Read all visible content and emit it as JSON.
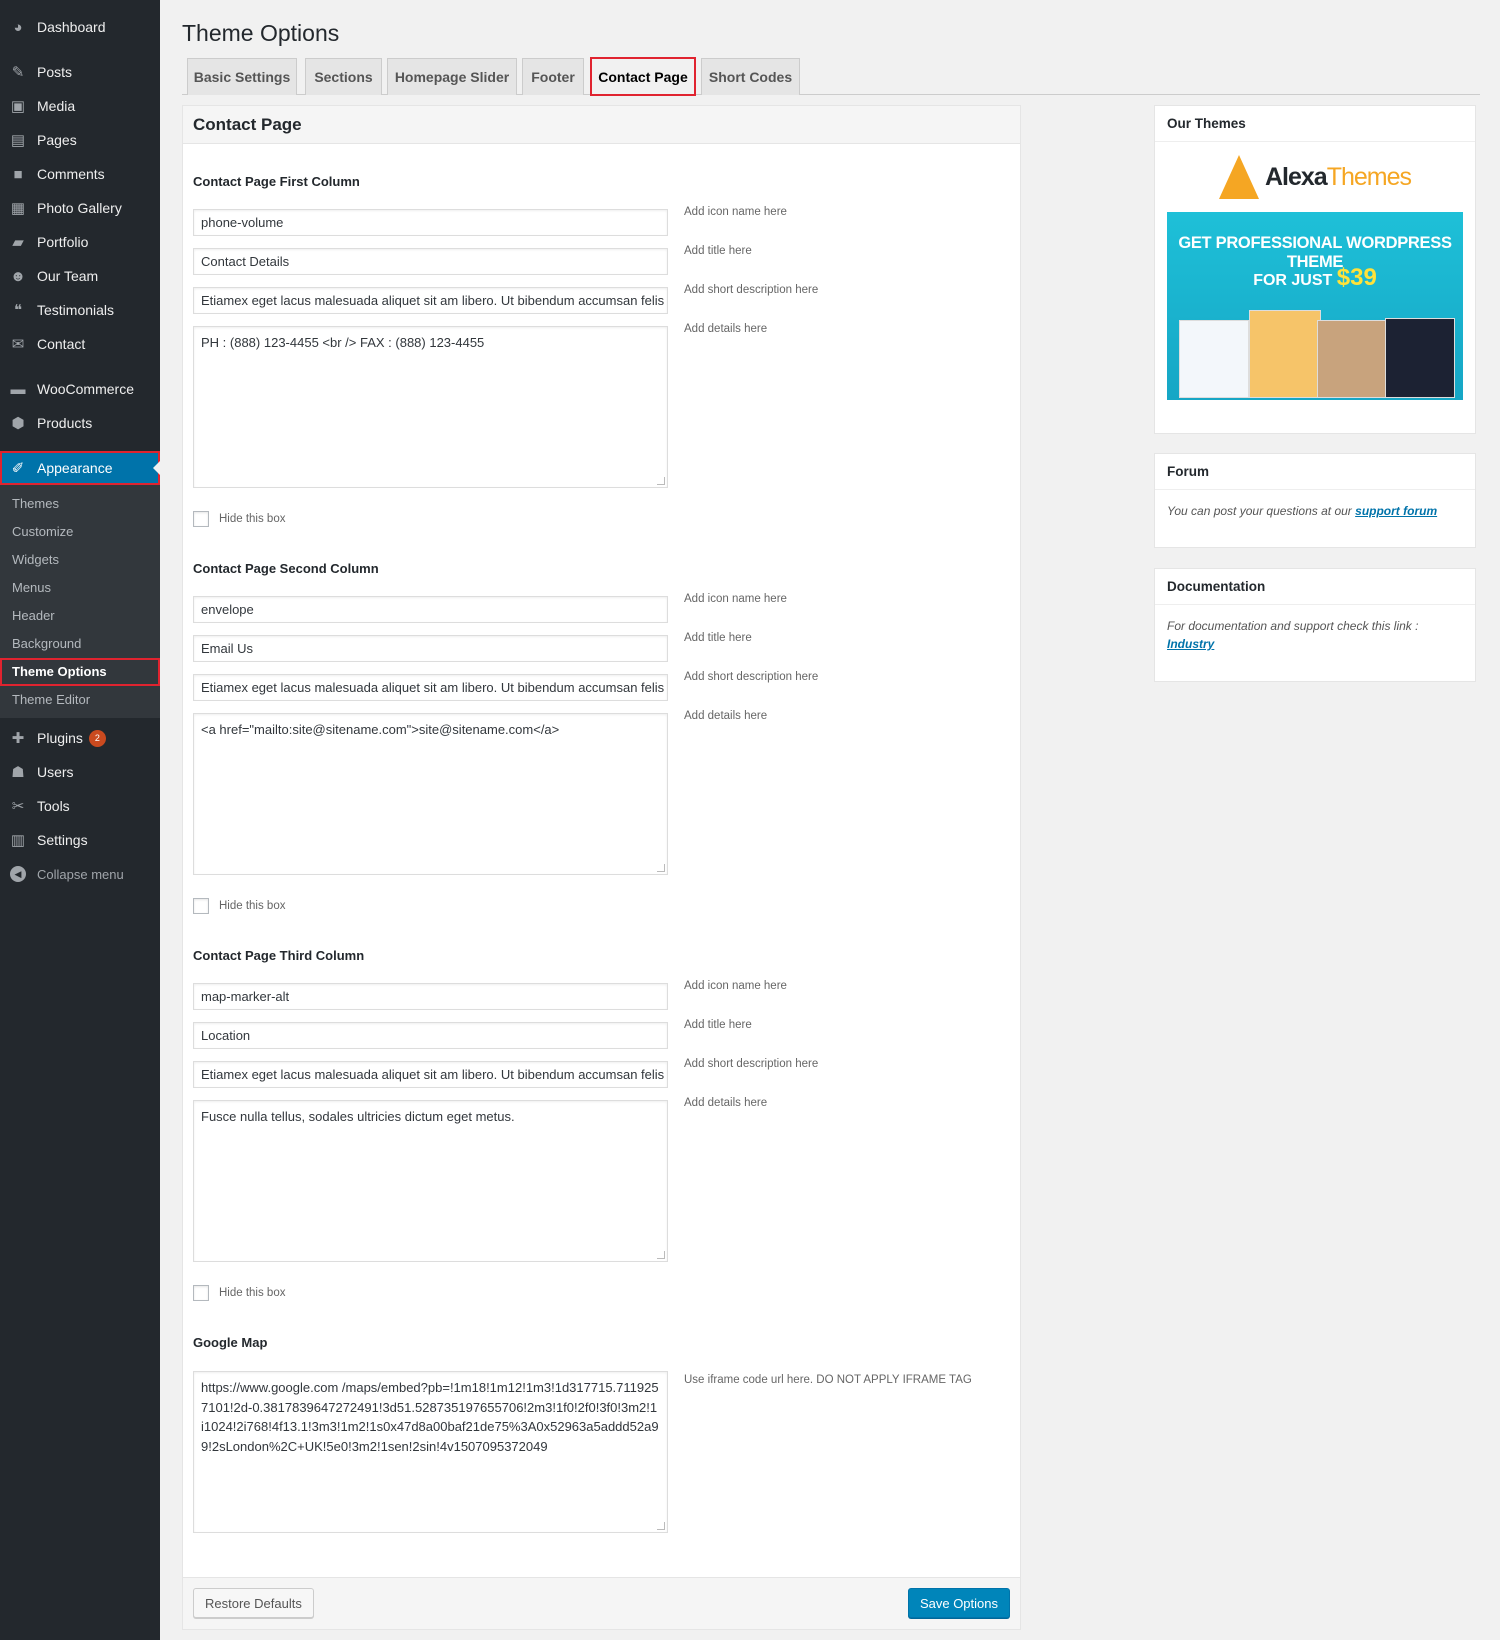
{
  "sidebar": {
    "items": [
      {
        "label": "Dashboard",
        "icon": "dashboard-icon",
        "glyph": "◕"
      },
      {
        "label": "Posts",
        "icon": "pin-icon",
        "glyph": "✎"
      },
      {
        "label": "Media",
        "icon": "media-icon",
        "glyph": "▣"
      },
      {
        "label": "Pages",
        "icon": "pages-icon",
        "glyph": "▤"
      },
      {
        "label": "Comments",
        "icon": "comments-icon",
        "glyph": "■"
      },
      {
        "label": "Photo Gallery",
        "icon": "gallery-icon",
        "glyph": "▦"
      },
      {
        "label": "Portfolio",
        "icon": "portfolio-icon",
        "glyph": "▰"
      },
      {
        "label": "Our Team",
        "icon": "team-icon",
        "glyph": "☻"
      },
      {
        "label": "Testimonials",
        "icon": "quote-icon",
        "glyph": "❝"
      },
      {
        "label": "Contact",
        "icon": "envelope-icon",
        "glyph": "✉"
      },
      {
        "label": "WooCommerce",
        "icon": "woo-icon",
        "glyph": "▬"
      },
      {
        "label": "Products",
        "icon": "products-icon",
        "glyph": "⬢"
      },
      {
        "label": "Appearance",
        "icon": "appearance-icon",
        "glyph": "✐"
      }
    ],
    "submenu": [
      "Themes",
      "Customize",
      "Widgets",
      "Menus",
      "Header",
      "Background",
      "Theme Options",
      "Theme Editor"
    ],
    "bottom_items": [
      {
        "label": "Plugins",
        "icon": "plugins-icon",
        "glyph": "✚",
        "badge": "2"
      },
      {
        "label": "Users",
        "icon": "users-icon",
        "glyph": "☗"
      },
      {
        "label": "Tools",
        "icon": "tools-icon",
        "glyph": "✂"
      },
      {
        "label": "Settings",
        "icon": "settings-icon",
        "glyph": "▥"
      }
    ],
    "collapse_label": "Collapse menu"
  },
  "page_title": "Theme Options",
  "tabs": [
    "Basic Settings",
    "Sections",
    "Homepage Slider",
    "Footer",
    "Contact Page",
    "Short Codes"
  ],
  "active_tab": "Contact Page",
  "box_title": "Contact Page",
  "hints": {
    "icon": "Add icon name here",
    "title": "Add title here",
    "short_desc": "Add short description here",
    "details": "Add details here",
    "hide": "Hide this box",
    "map": "Use iframe code url here. DO NOT APPLY IFRAME TAG"
  },
  "columns": [
    {
      "heading": "Contact Page First Column",
      "icon": "phone-volume",
      "title": "Contact Details",
      "short_desc": "Etiamex eget lacus malesuada aliquet sit am libero. Ut bibendum accumsan felis",
      "details": "PH : (888) 123-4455 <br /> FAX : (888) 123-4455"
    },
    {
      "heading": "Contact Page Second Column",
      "icon": "envelope",
      "title": "Email Us",
      "short_desc": "Etiamex eget lacus malesuada aliquet sit am libero. Ut bibendum accumsan felis",
      "details": "<a href=\"mailto:site@sitename.com\">site@sitename.com</a>"
    },
    {
      "heading": "Contact Page Third Column",
      "icon": "map-marker-alt",
      "title": "Location",
      "short_desc": "Etiamex eget lacus malesuada aliquet sit am libero. Ut bibendum accumsan felis",
      "details": "Fusce nulla tellus, sodales ultricies dictum eget metus."
    }
  ],
  "google_map": {
    "heading": "Google Map",
    "value": "https://www.google.com /maps/embed?pb=!1m18!1m12!1m3!1d317715.7119257101!2d-0.3817839647272491!3d51.528735197655706!2m3!1f0!2f0!3f0!3m2!1i1024!2i768!4f13.1!3m3!1m2!1s0x47d8a00baf21de75%3A0x52963a5addd52a99!2sLondon%2C+UK!5e0!3m2!1sen!2sin!4v1507095372049"
  },
  "buttons": {
    "restore": "Restore Defaults",
    "save": "Save Options"
  },
  "widgets": {
    "themes": {
      "title": "Our Themes",
      "logo_a": "Alexa",
      "logo_b": "Themes",
      "promo_line1": "GET PROFESSIONAL WORDPRESS THEME",
      "promo_line2": "FOR JUST",
      "promo_price": "$39"
    },
    "forum": {
      "title": "Forum",
      "text": "You can post your questions at our",
      "link": "support forum"
    },
    "docs": {
      "title": "Documentation",
      "text": "For documentation and support check this link :",
      "link": "Industry"
    }
  },
  "colors": {
    "accent": "#0073aa",
    "highlight": "#e0232f",
    "sidebar_bg": "#23282d",
    "primary_button": "#0085ba"
  }
}
